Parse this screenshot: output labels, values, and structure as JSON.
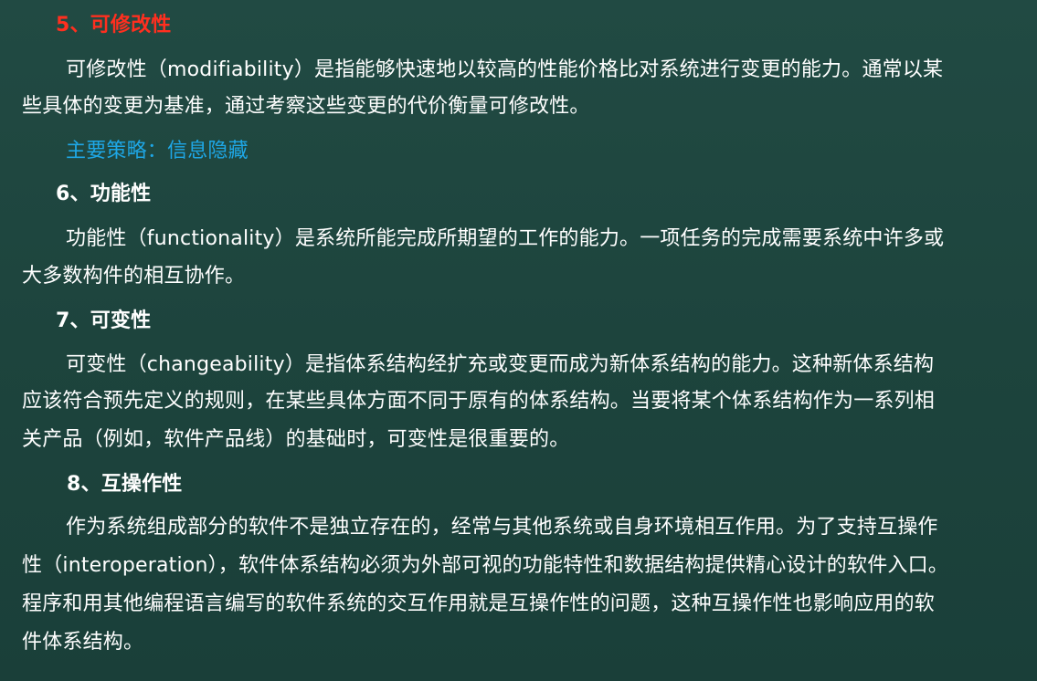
{
  "sections": [
    {
      "heading": "5、可修改性",
      "lines": [
        "可修改性（modifiability）是指能够快速地以较高的性能价格比对系统进行变更的能力。通常以某",
        "些具体的变更为基准，通过考察这些变更的代价衡量可修改性。"
      ],
      "strategy": "主要策略：信息隐藏"
    },
    {
      "heading": "6、功能性",
      "lines": [
        "功能性（functionality）是系统所能完成所期望的工作的能力。一项任务的完成需要系统中许多或",
        "大多数构件的相互协作。"
      ]
    },
    {
      "heading": "7、可变性",
      "lines": [
        "可变性（changeability）是指体系结构经扩充或变更而成为新体系结构的能力。这种新体系结构",
        "应该符合预先定义的规则，在某些具体方面不同于原有的体系结构。当要将某个体系结构作为一系列相",
        "关产品（例如，软件产品线）的基础时，可变性是很重要的。"
      ]
    },
    {
      "heading": "8、互操作性",
      "lines": [
        "作为系统组成部分的软件不是独立存在的，经常与其他系统或自身环境相互作用。为了支持互操作",
        "性（interoperation），软件体系结构必须为外部可视的功能特性和数据结构提供精心设计的软件入口。",
        "程序和用其他编程语言编写的软件系统的交互作用就是互操作性的问题，这种互操作性也影响应用的软",
        "件体系结构。"
      ]
    }
  ]
}
